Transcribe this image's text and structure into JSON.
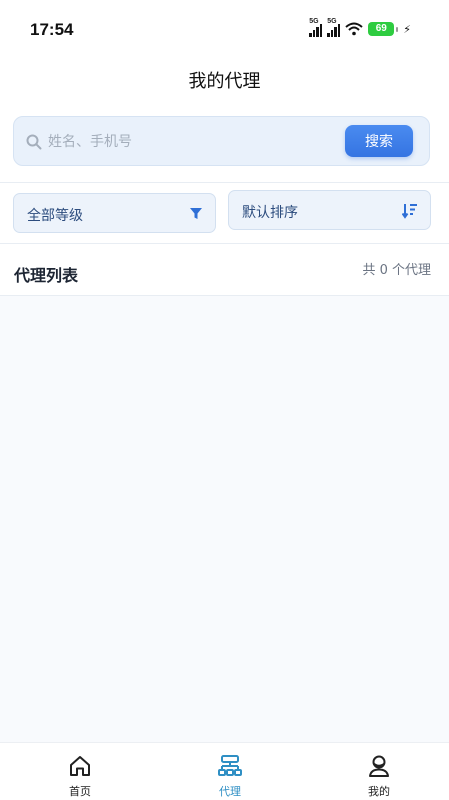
{
  "status": {
    "time": "17:54",
    "signal1_label": "5G",
    "signal2_label": "5G",
    "battery": "69"
  },
  "header": {
    "title": "我的代理"
  },
  "search": {
    "placeholder": "姓名、手机号",
    "button_label": "搜索"
  },
  "filters": {
    "level_label": "全部等级",
    "sort_label": "默认排序"
  },
  "list": {
    "title": "代理列表",
    "count_text": "共 0 个代理"
  },
  "tabbar": {
    "items": [
      {
        "label": "首页",
        "icon": "home-icon",
        "active": false
      },
      {
        "label": "代理",
        "icon": "agent-network-icon",
        "active": true
      },
      {
        "label": "我的",
        "icon": "user-icon",
        "active": false
      }
    ]
  },
  "colors": {
    "accent": "#3574e2",
    "active_tab": "#2f8fc4",
    "battery": "#2ecc40"
  }
}
